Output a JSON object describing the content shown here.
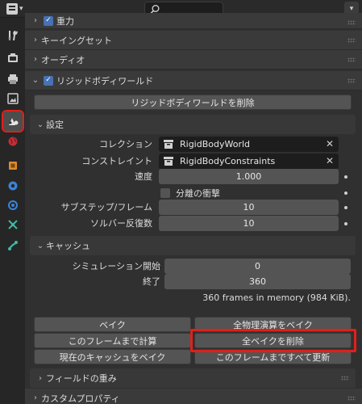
{
  "header": {
    "search_placeholder": "",
    "editor_icon": "properties-editor-icon",
    "menu_icon": "chevron-down-icon"
  },
  "tabs": [
    {
      "name": "tool",
      "icon": "wrench-screwdriver-icon"
    },
    {
      "name": "render",
      "icon": "camera-back-icon"
    },
    {
      "name": "output",
      "icon": "printer-icon"
    },
    {
      "name": "view-layer",
      "icon": "image-icon"
    },
    {
      "name": "scene",
      "icon": "scene-icon",
      "active": true
    },
    {
      "name": "world",
      "icon": "world-globe-icon"
    },
    {
      "name": "object",
      "icon": "object-cube-icon"
    },
    {
      "name": "modifiers",
      "icon": "wrench-blue-icon"
    },
    {
      "name": "particles",
      "icon": "particles-icon"
    },
    {
      "name": "physics",
      "icon": "physics-icon"
    },
    {
      "name": "constraints",
      "icon": "constraints-icon"
    },
    {
      "name": "data",
      "icon": "bone-icon"
    }
  ],
  "panels": {
    "gravity": "重力",
    "keying_sets": "キーイングセット",
    "audio": "オーディオ",
    "rigid_body_world": "リジッドボディワールド",
    "remove_world_button": "リジッドボディワールドを削除",
    "settings": "設定",
    "collection_label": "コレクション",
    "collection_value": "RigidBodyWorld",
    "constraints_label": "コンストレイント",
    "constraints_value": "RigidBodyConstraints",
    "speed_label": "速度",
    "speed_value": "1.000",
    "split_impulse_label": "分離の衝撃",
    "substeps_label": "サブステップ/フレーム",
    "substeps_value": "10",
    "solver_iter_label": "ソルバー反復数",
    "solver_iter_value": "10",
    "cache": "キャッシュ",
    "sim_start_label": "シミュレーション開始",
    "sim_start_value": "0",
    "end_label": "終了",
    "end_value": "360",
    "memory_info": "360 frames in memory (984 KiB).",
    "bake_button": "ベイク",
    "bake_all_button": "全物理演算をベイク",
    "calc_to_frame_button": "このフレームまで計算",
    "delete_all_bakes_button": "全ベイクを削除",
    "current_cache_to_bake_button": "現在のキャッシュをベイク",
    "update_all_to_frame_button": "このフレームまですべて更新",
    "field_weights": "フィールドの重み",
    "custom_properties": "カスタムプロパティ"
  },
  "colors": {
    "accent": "#4772b3",
    "highlight_red": "#e0201a"
  }
}
